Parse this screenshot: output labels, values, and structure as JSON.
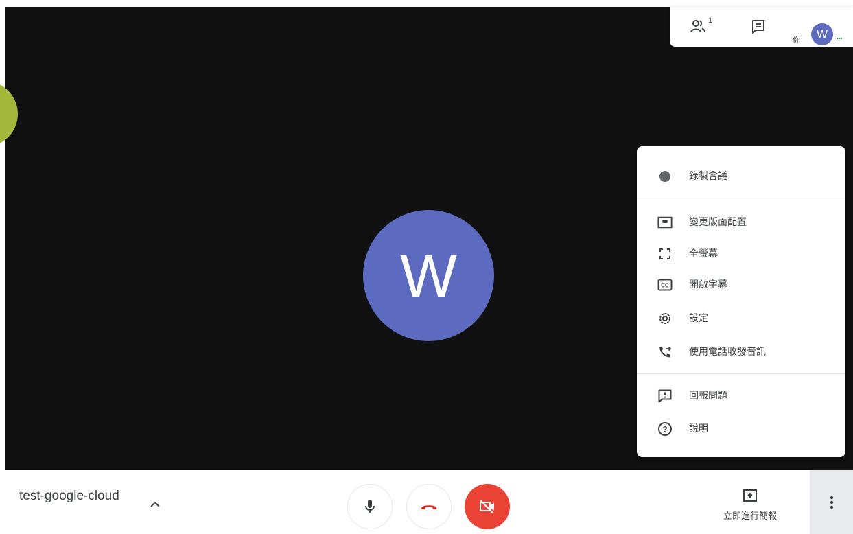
{
  "stage": {
    "participant_initial": "W"
  },
  "top_panel": {
    "people_icon": "people-icon",
    "people_count": "1",
    "chat_icon": "chat-icon",
    "you_label": "你",
    "self_initial": "W",
    "more_dots": "..."
  },
  "menu": {
    "items": [
      {
        "icon": "record-dot-icon",
        "label": "錄製會議"
      },
      {
        "icon": "layout-icon",
        "label": "變更版面配置"
      },
      {
        "icon": "fullscreen-icon",
        "label": "全螢幕"
      },
      {
        "icon": "captions-icon",
        "label": "開啟字幕"
      },
      {
        "icon": "settings-gear-icon",
        "label": "設定"
      },
      {
        "icon": "phone-forward-icon",
        "label": "使用電話收發音訊"
      },
      {
        "icon": "feedback-icon",
        "label": "回報問題"
      },
      {
        "icon": "help-icon",
        "label": "說明"
      }
    ]
  },
  "bottom_bar": {
    "meeting_name": "test-google-cloud",
    "present_label": "立即進行簡報"
  },
  "colors": {
    "avatar": "#5c6bc0",
    "stage_bg": "#111111",
    "camera_off_red": "#ea4335",
    "accent_green": "#1e8e3e"
  }
}
